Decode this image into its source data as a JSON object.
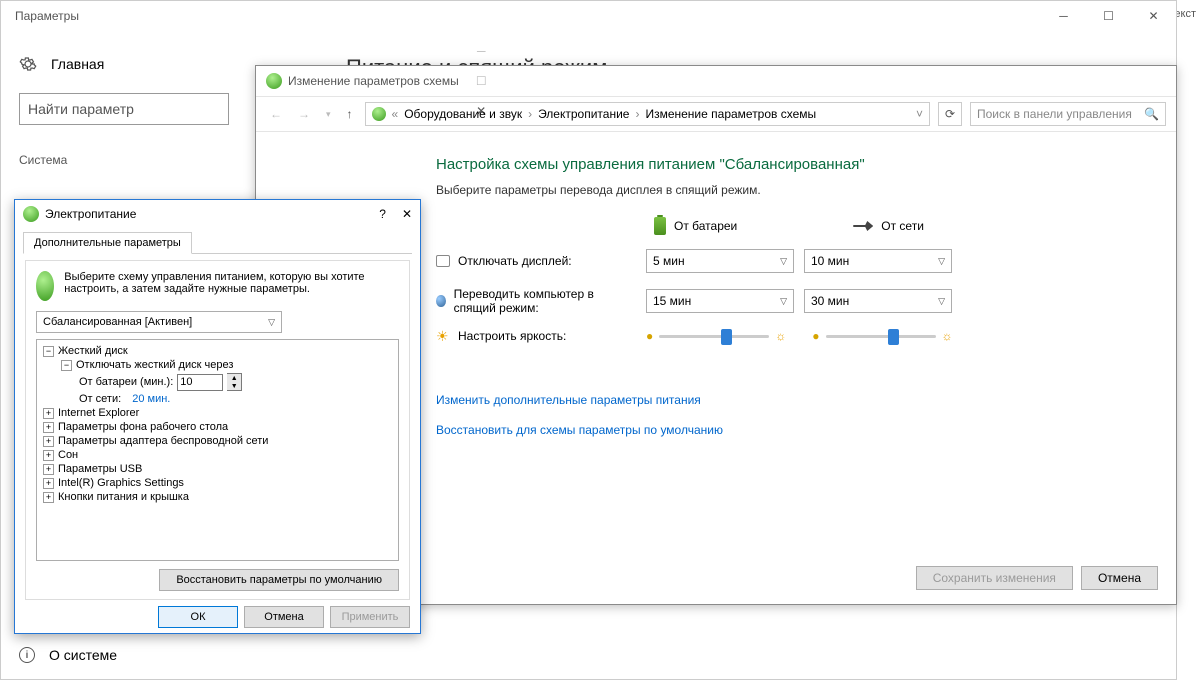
{
  "bg_text": "Текст",
  "settings": {
    "title": "Параметры",
    "home": "Главная",
    "search_placeholder": "Найти параметр",
    "category": "Система",
    "about": "О системе",
    "main_heading": "Питание и спящий режим"
  },
  "plan": {
    "title": "Изменение параметров схемы",
    "breadcrumb": [
      "Оборудование и звук",
      "Электропитание",
      "Изменение параметров схемы"
    ],
    "search_placeholder": "Поиск в панели управления",
    "heading": "Настройка схемы управления питанием \"Сбалансированная\"",
    "subtext": "Выберите параметры перевода дисплея в спящий режим.",
    "col_battery": "От батареи",
    "col_plugged": "От сети",
    "row_display": "Отключать дисплей:",
    "row_sleep": "Переводить компьютер в спящий режим:",
    "row_brightness": "Настроить яркость:",
    "display_battery": "5 мин",
    "display_plugged": "10 мин",
    "sleep_battery": "15 мин",
    "sleep_plugged": "30 мин",
    "link_advanced": "Изменить дополнительные параметры питания",
    "link_restore": "Восстановить для схемы параметры по умолчанию",
    "btn_save": "Сохранить изменения",
    "btn_cancel": "Отмена"
  },
  "pwr": {
    "title": "Электропитание",
    "tab": "Дополнительные параметры",
    "intro": "Выберите схему управления питанием, которую вы хотите настроить, а затем задайте нужные параметры.",
    "scheme": "Сбалансированная [Активен]",
    "tree": {
      "hdd": "Жесткий диск",
      "hdd_turnoff": "Отключать жесткий диск через",
      "on_battery_label": "От батареи (мин.):",
      "on_battery_value": "10",
      "on_ac_label": "От сети:",
      "on_ac_value": "20 мин.",
      "ie": "Internet Explorer",
      "desktop_bg": "Параметры фона рабочего стола",
      "wifi": "Параметры адаптера беспроводной сети",
      "sleep": "Сон",
      "usb": "Параметры USB",
      "gfx": "Intel(R) Graphics Settings",
      "buttons_lid": "Кнопки питания и крышка"
    },
    "btn_restore": "Восстановить параметры по умолчанию",
    "btn_ok": "ОК",
    "btn_cancel": "Отмена",
    "btn_apply": "Применить"
  }
}
